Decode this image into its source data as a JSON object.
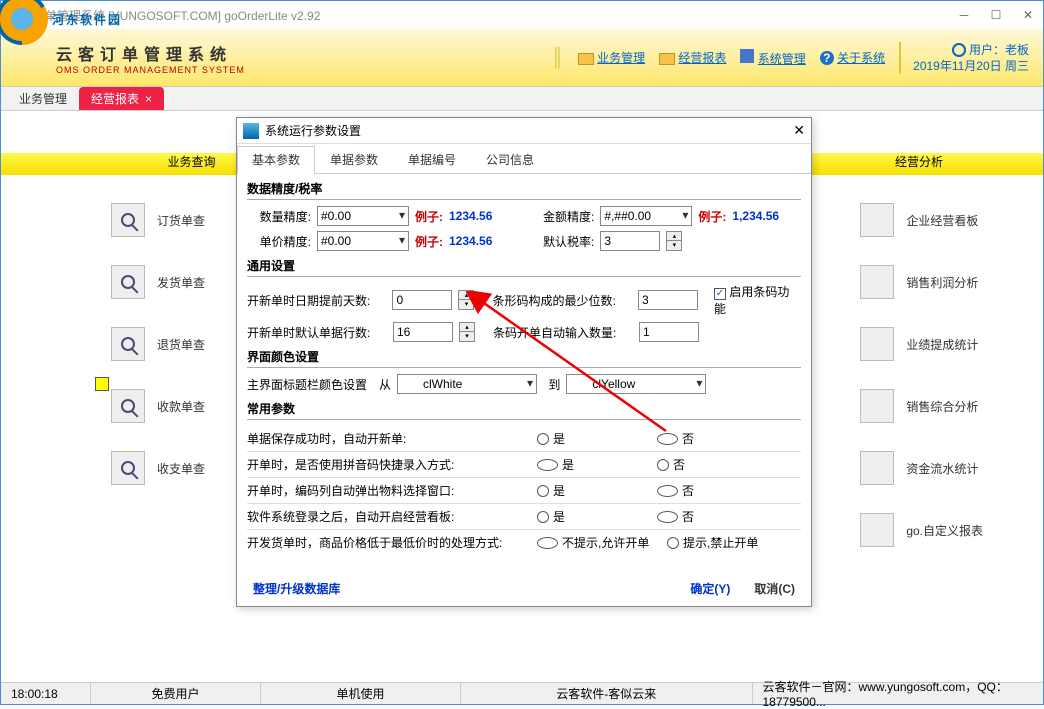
{
  "window": {
    "title": "云客订单管理系统 [YUNGOSOFT.COM]  goOrderLite v2.92"
  },
  "watermark": "河东软件园",
  "header": {
    "brand_cn": "云客订单管理系统",
    "brand_en": "OMS ORDER MANAGEMENT SYSTEM",
    "menu_biz": "业务管理",
    "menu_report": "经营报表",
    "menu_sys": "系统管理",
    "menu_about": "关于系统",
    "user_label": "用户：",
    "user_name": "老板",
    "date": "2019年11月20日 周三"
  },
  "main_tabs": {
    "t1": "业务管理",
    "t2": "经营报表"
  },
  "bands": {
    "left": "业务查询",
    "right": "经营分析"
  },
  "left_items": [
    "订货单查",
    "发货单查",
    "退货单查",
    "收款单查",
    "收支单查"
  ],
  "right_items": [
    "企业经营看板",
    "销售利润分析",
    "业绩提成统计",
    "销售综合分析",
    "资金流水统计",
    "go.自定义报表"
  ],
  "dialog": {
    "title": "系统运行参数设置",
    "tabs": [
      "基本参数",
      "单据参数",
      "单据编号",
      "公司信息"
    ],
    "sect1": "数据精度/税率",
    "qty_label": "数量精度:",
    "qty_val": "#0.00",
    "eg_lbl": "例子:",
    "eg_val": "1234.56",
    "amt_label": "金额精度:",
    "amt_val": "#,##0.00",
    "amt_eg": "1,234.56",
    "price_label": "单价精度:",
    "price_val": "#0.00",
    "tax_label": "默认税率:",
    "tax_val": "3",
    "sect2": "通用设置",
    "g1": "开新单时日期提前天数:",
    "g1v": "0",
    "g2": "条形码构成的最少位数:",
    "g2v": "3",
    "g3": "开新单时默认单据行数:",
    "g3v": "16",
    "g4": "条码开单自动输入数量:",
    "g4v": "1",
    "chk_barcode": "启用条码功能",
    "sect3": "界面颜色设置",
    "color_lbl": "主界面标题栏颜色设置",
    "from": "从",
    "to": "到",
    "c1": "clWhite",
    "c2": "clYellow",
    "sect4": "常用参数",
    "yes": "是",
    "no": "否",
    "r1": "单据保存成功时，自动开新单:",
    "r2": "开单时，是否使用拼音码快捷录入方式:",
    "r3": "开单时，编码列自动弹出物料选择窗口:",
    "r4": "软件系统登录之后，自动开启经营看板:",
    "r5": "开发货单时，商品价格低于最低价时的处理方式:",
    "r5a": "不提示,允许开单",
    "r5b": "提示,禁止开单",
    "r_sel": {
      "r1": "no",
      "r2": "yes",
      "r3": "no",
      "r4": "no",
      "r5": "a"
    },
    "db_link": "整理/升级数据库",
    "ok": "确定(Y)",
    "cancel": "取消(C)"
  },
  "status": {
    "time": "18:00:18",
    "s1": "免费用户",
    "s2": "单机使用",
    "s3": "云客软件-客似云来",
    "s4": "云客软件－官网：www.yungosoft.com，QQ：18779500..."
  }
}
